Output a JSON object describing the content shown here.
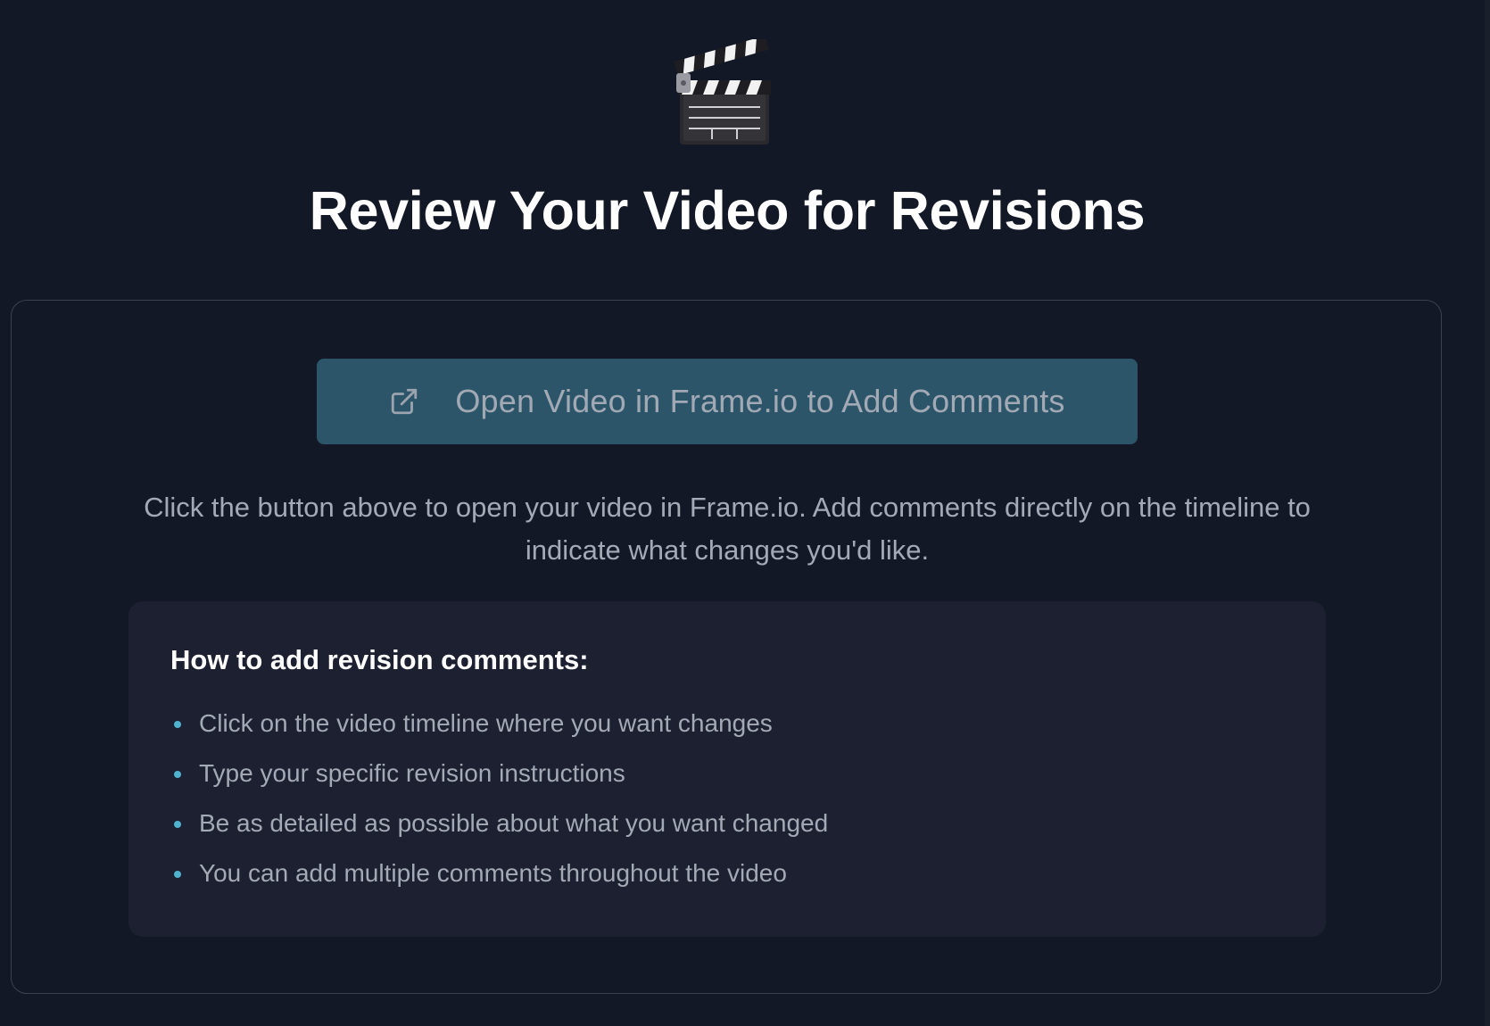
{
  "hero": {
    "icon": "clapper-board-icon"
  },
  "page": {
    "title": "Review Your Video for Revisions"
  },
  "card": {
    "button_label": "Open Video in Frame.io to Add Comments",
    "button_icon": "external-link-icon",
    "description": "Click the button above to open your video in Frame.io. Add comments directly on the timeline to indicate what changes you'd like."
  },
  "instructions": {
    "heading": "How to add revision comments:",
    "items": [
      "Click on the video timeline where you want changes",
      "Type your specific revision instructions",
      "Be as detailed as possible about what you want changed",
      "You can add multiple comments throughout the video"
    ]
  },
  "colors": {
    "background": "#131826",
    "button": "#2d5569",
    "bullet_accent": "#4fb3cf",
    "panel": "#1c2030"
  }
}
